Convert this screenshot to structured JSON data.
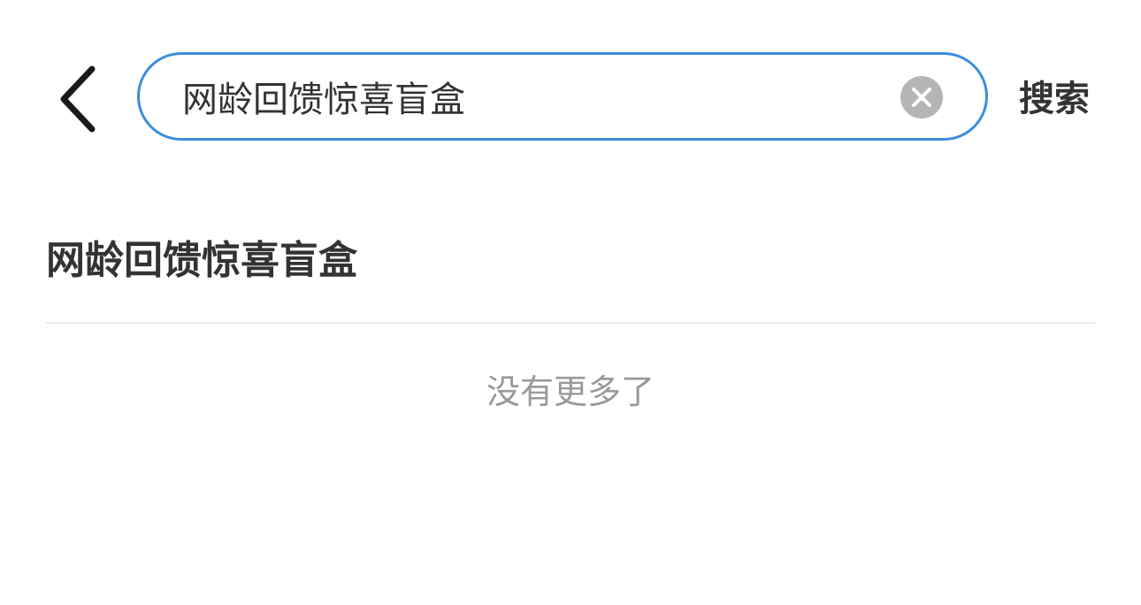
{
  "header": {
    "back_icon": "chevron-left-icon",
    "search": {
      "value": "网龄回馈惊喜盲盒",
      "placeholder": "",
      "clear_icon": "close-circle-icon",
      "border_color": "#3a8fdc"
    },
    "search_label": "搜索"
  },
  "results": {
    "items": [
      {
        "label": "网龄回馈惊喜盲盒"
      }
    ],
    "end_text": "没有更多了"
  },
  "colors": {
    "text_primary": "#333333",
    "text_secondary": "#999999",
    "clear_bg": "#b5b5b5"
  }
}
